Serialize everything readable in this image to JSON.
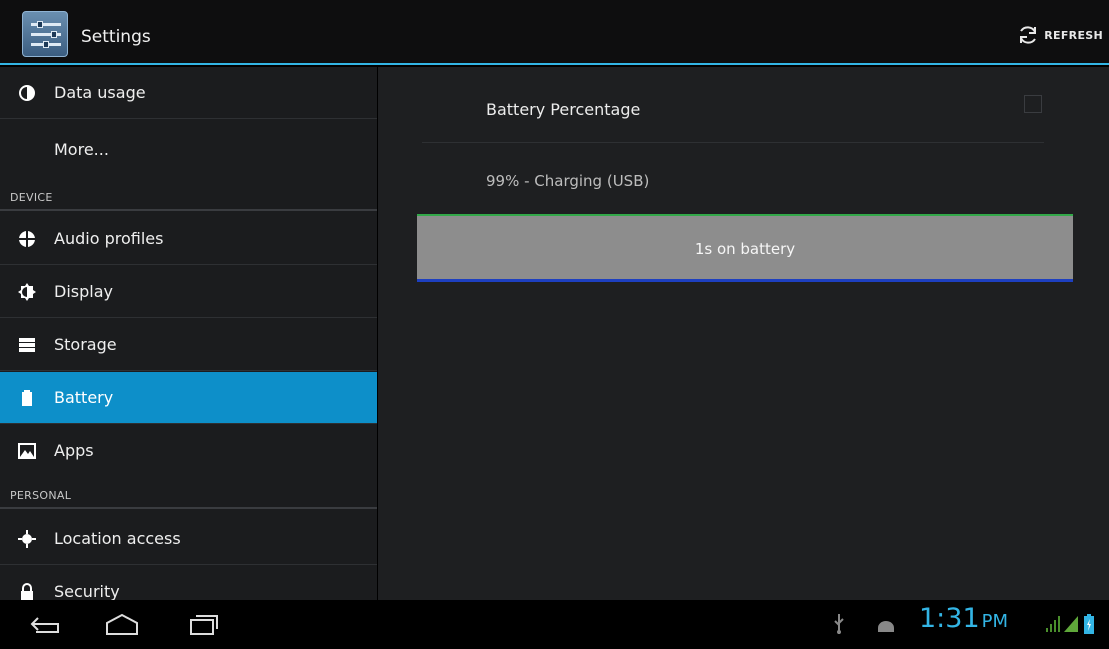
{
  "app": {
    "title": "Settings"
  },
  "actions": {
    "refresh_label": "REFRESH"
  },
  "sidebar": {
    "items": [
      {
        "label": "Data usage",
        "icon": "data-usage-icon"
      },
      {
        "label": "More..."
      },
      {
        "header": "DEVICE"
      },
      {
        "label": "Audio profiles",
        "icon": "audio-profiles-icon"
      },
      {
        "label": "Display",
        "icon": "display-icon"
      },
      {
        "label": "Storage",
        "icon": "storage-icon"
      },
      {
        "label": "Battery",
        "icon": "battery-icon",
        "selected": true
      },
      {
        "label": "Apps",
        "icon": "apps-icon"
      },
      {
        "header": "PERSONAL"
      },
      {
        "label": "Location access",
        "icon": "location-icon"
      },
      {
        "label": "Security",
        "icon": "lock-icon"
      }
    ]
  },
  "battery": {
    "percentage_pref_label": "Battery Percentage",
    "percentage_checked": false,
    "status": "99% - Charging (USB)",
    "time_on_battery": "1s on battery"
  },
  "statusbar": {
    "time": "1:31",
    "ampm": "PM"
  },
  "colors": {
    "accent": "#33b5e5",
    "selected": "#0d8fc9",
    "charge_green": "#32a849",
    "charge_blue": "#1d3fc0"
  }
}
